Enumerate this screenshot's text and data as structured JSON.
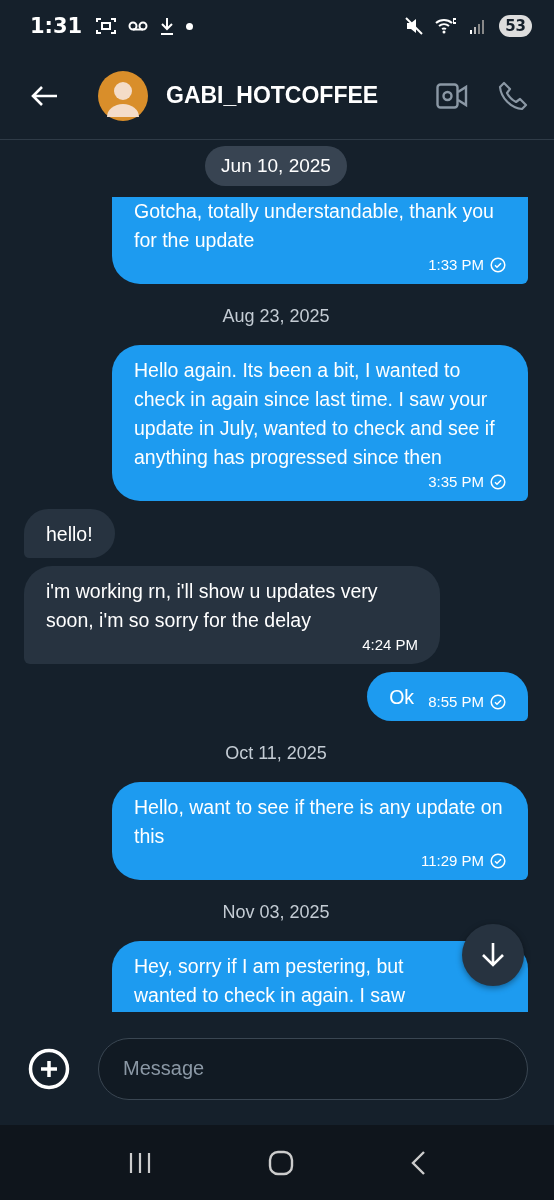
{
  "status_bar": {
    "time": "1:31",
    "battery": "53"
  },
  "header": {
    "name": "GABI_HOTCOFFEE"
  },
  "sticky_date": "Jun 10, 2025",
  "messages": [
    {
      "kind": "out",
      "text": "Gotcha, totally understandable, thank you for the update",
      "time": "1:33 PM",
      "read": true
    },
    {
      "kind": "date",
      "text": "Aug 23, 2025"
    },
    {
      "kind": "out",
      "text": "Hello again. Its been a bit, I wanted to check in again since last time. I saw your update in July, wanted to check and see if anything has progressed since then",
      "time": "3:35 PM",
      "read": true
    },
    {
      "kind": "in",
      "text": "hello!"
    },
    {
      "kind": "in",
      "text": "i'm working rn, i'll show u updates very soon, i'm so sorry for the delay",
      "time": "4:24 PM"
    },
    {
      "kind": "out",
      "text": "Ok",
      "time": "8:55 PM",
      "read": true
    },
    {
      "kind": "date",
      "text": "Oct 11, 2025"
    },
    {
      "kind": "out",
      "text": "Hello, want to see if there is any update on this",
      "time": "11:29 PM",
      "read": true
    },
    {
      "kind": "date",
      "text": "Nov 03, 2025"
    },
    {
      "kind": "out",
      "text": "Hey, sorry if I am pestering, but\nwanted to check in again. I saw"
    }
  ],
  "composer": {
    "placeholder": "Message"
  }
}
